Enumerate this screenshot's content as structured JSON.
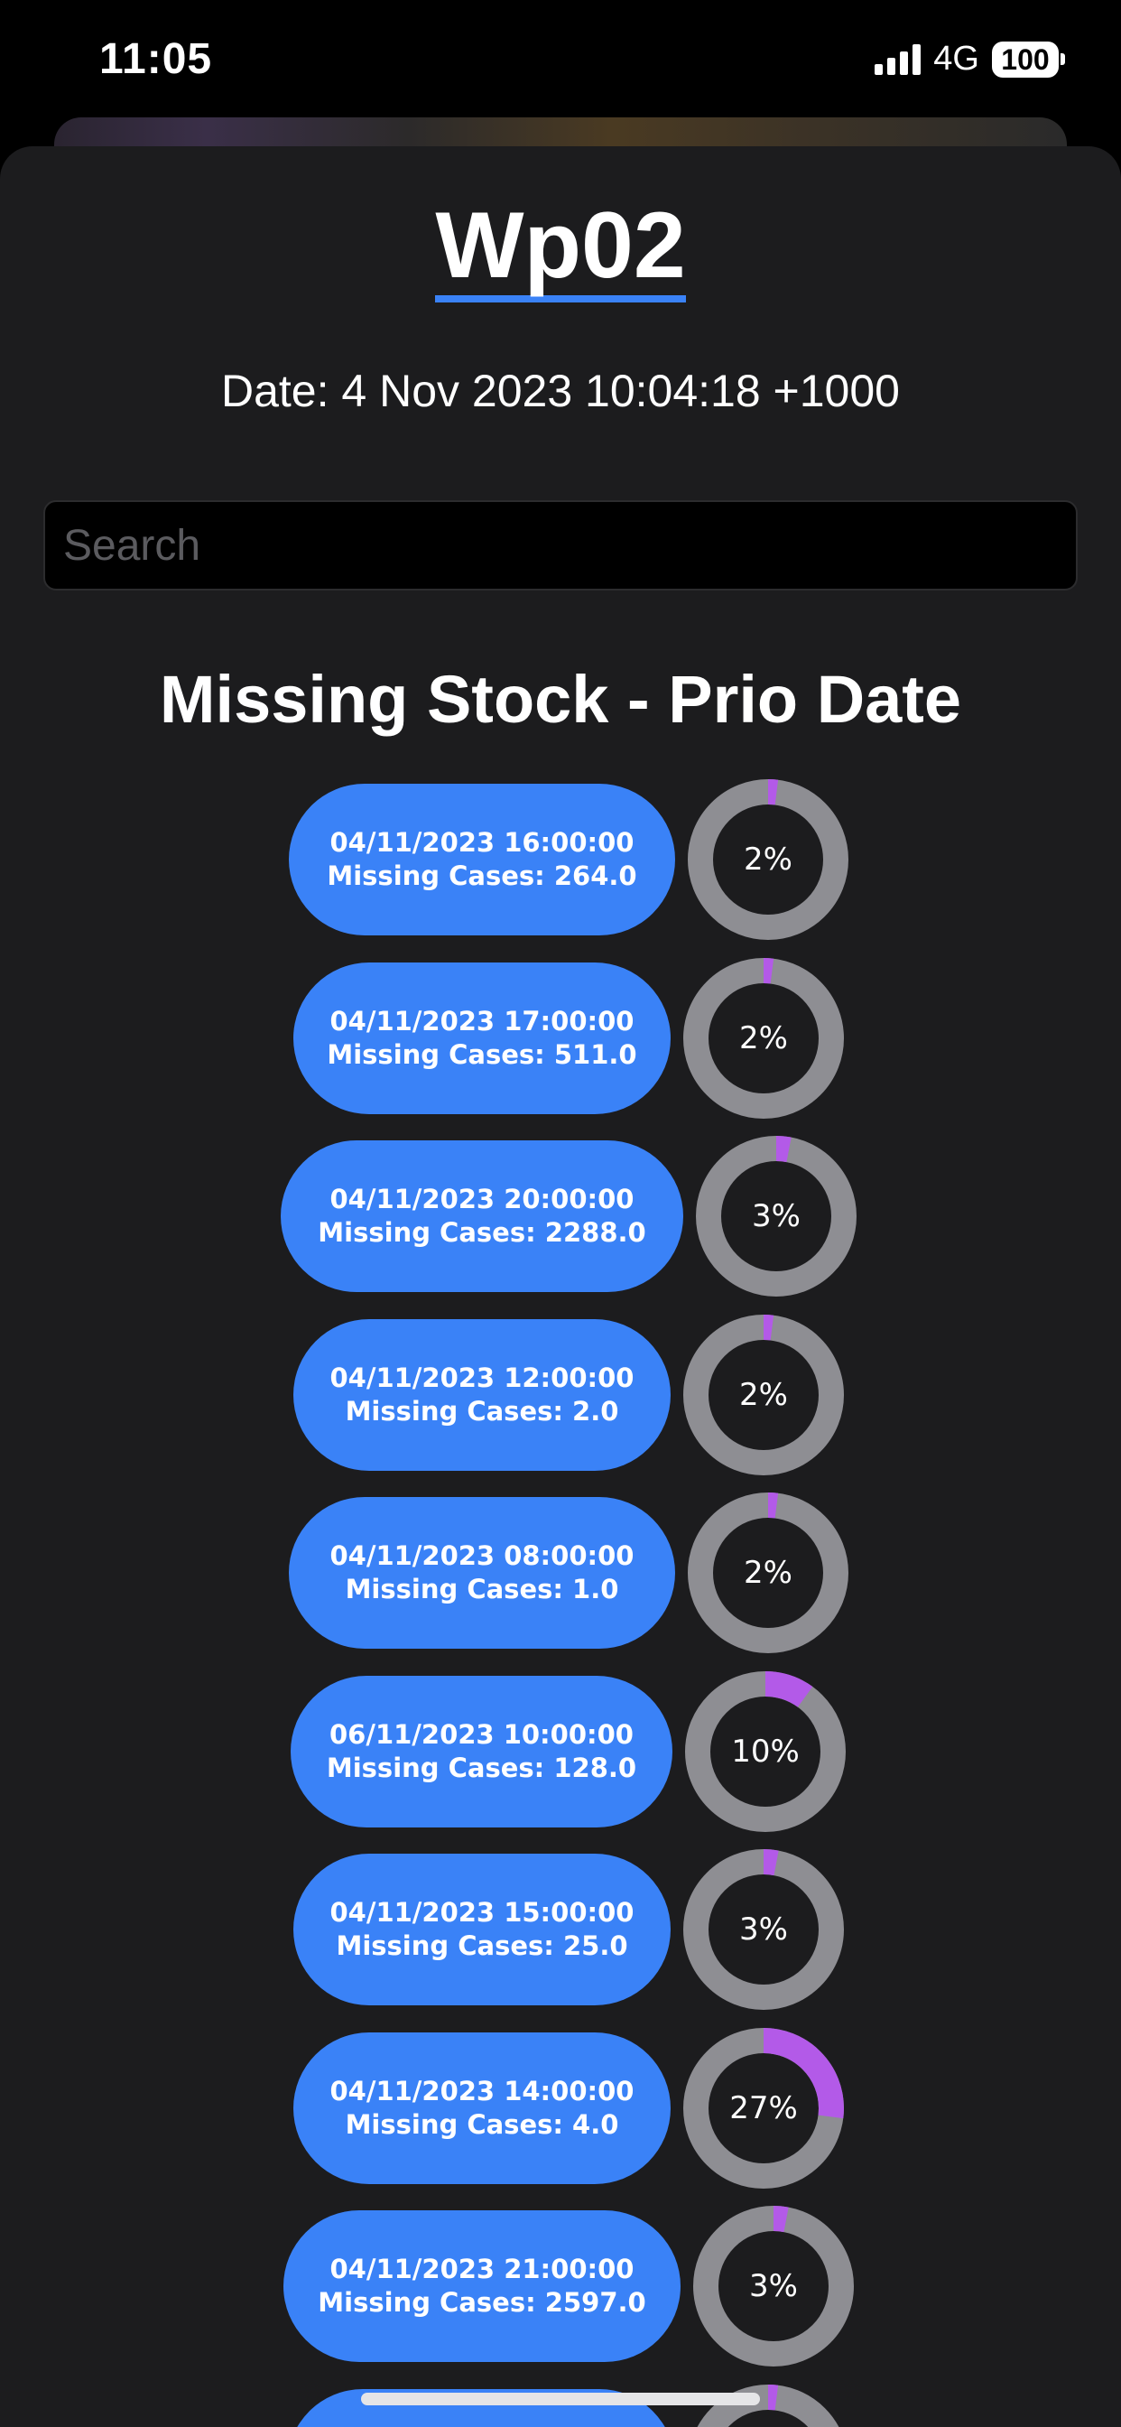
{
  "status_bar": {
    "time": "11:05",
    "network": "4G",
    "battery": "100"
  },
  "header": {
    "title": "Wp02",
    "date_line": "Date: 4 Nov 2023 10:04:18 +1000"
  },
  "search": {
    "placeholder": "Search",
    "value": ""
  },
  "section": {
    "heading": "Missing Stock - Prio Date"
  },
  "colors": {
    "pill": "#3a82f7",
    "ring_track": "#8e8e93",
    "ring_fill": "#b35ae8",
    "sheet_bg": "#1c1c1e"
  },
  "items": [
    {
      "date": "04/11/2023 16:00:00",
      "cases": "Missing Cases: 264.0",
      "percent_label": "2%",
      "percent": 2
    },
    {
      "date": "04/11/2023 17:00:00",
      "cases": "Missing Cases: 511.0",
      "percent_label": "2%",
      "percent": 2
    },
    {
      "date": "04/11/2023 20:00:00",
      "cases": "Missing Cases: 2288.0",
      "percent_label": "3%",
      "percent": 3
    },
    {
      "date": "04/11/2023 12:00:00",
      "cases": "Missing Cases: 2.0",
      "percent_label": "2%",
      "percent": 2
    },
    {
      "date": "04/11/2023 08:00:00",
      "cases": "Missing Cases: 1.0",
      "percent_label": "2%",
      "percent": 2
    },
    {
      "date": "06/11/2023 10:00:00",
      "cases": "Missing Cases: 128.0",
      "percent_label": "10%",
      "percent": 10
    },
    {
      "date": "04/11/2023 15:00:00",
      "cases": "Missing Cases: 25.0",
      "percent_label": "3%",
      "percent": 3
    },
    {
      "date": "04/11/2023 14:00:00",
      "cases": "Missing Cases: 4.0",
      "percent_label": "27%",
      "percent": 27
    },
    {
      "date": "04/11/2023 21:00:00",
      "cases": "Missing Cases: 2597.0",
      "percent_label": "3%",
      "percent": 3
    },
    {
      "date": "",
      "cases": "",
      "percent_label": "",
      "percent": 2
    }
  ]
}
